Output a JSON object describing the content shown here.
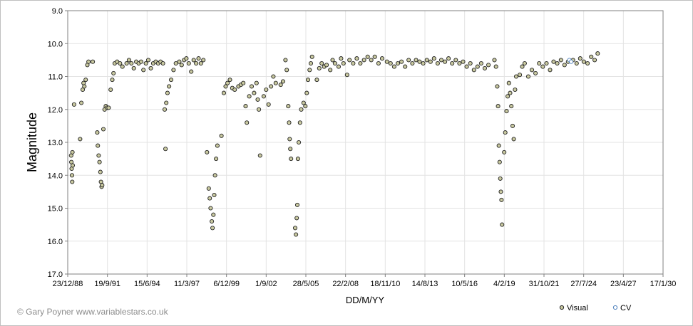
{
  "chart_data": {
    "type": "scatter",
    "title": "",
    "xlabel": "DD/M/YY",
    "ylabel": "Magnitude",
    "x_ticks": [
      "23/12/88",
      "19/9/91",
      "15/6/94",
      "11/3/97",
      "6/12/99",
      "1/9/02",
      "28/5/05",
      "22/2/08",
      "18/11/10",
      "14/8/13",
      "10/5/16",
      "4/2/19",
      "31/10/21",
      "27/7/24",
      "23/4/27",
      "17/1/30"
    ],
    "y_ticks": [
      "9.0",
      "10.0",
      "11.0",
      "12.0",
      "13.0",
      "14.0",
      "15.0",
      "16.0",
      "17.0"
    ],
    "xlim": [
      "1988-12-23",
      "2030-01-17"
    ],
    "ylim": [
      17.0,
      9.0
    ],
    "y_inverted": true,
    "grid": true,
    "legend_position": "bottom-right",
    "series": [
      {
        "name": "Visual",
        "color": "#c9c9a0",
        "edge_color": "#222222",
        "points": [
          [
            "1989-03-20",
            13.4
          ],
          [
            "1989-03-25",
            13.6
          ],
          [
            "1989-04-01",
            13.8
          ],
          [
            "1989-04-10",
            14.0
          ],
          [
            "1989-04-15",
            14.2
          ],
          [
            "1989-04-20",
            13.3
          ],
          [
            "1989-04-28",
            13.7
          ],
          [
            "1989-06-01",
            11.85
          ],
          [
            "1989-11-01",
            12.9
          ],
          [
            "1989-12-01",
            11.8
          ],
          [
            "1990-01-05",
            11.4
          ],
          [
            "1990-01-25",
            11.2
          ],
          [
            "1990-02-15",
            11.3
          ],
          [
            "1990-03-20",
            11.1
          ],
          [
            "1990-05-01",
            10.65
          ],
          [
            "1990-06-01",
            10.55
          ],
          [
            "1990-09-15",
            10.55
          ],
          [
            "1991-01-05",
            12.7
          ],
          [
            "1991-01-20",
            13.1
          ],
          [
            "1991-02-10",
            13.4
          ],
          [
            "1991-03-05",
            13.6
          ],
          [
            "1991-03-25",
            13.9
          ],
          [
            "1991-04-10",
            14.2
          ],
          [
            "1991-04-25",
            14.35
          ],
          [
            "1991-05-10",
            14.3
          ],
          [
            "1991-06-10",
            12.6
          ],
          [
            "1991-07-10",
            12.0
          ],
          [
            "1991-08-10",
            11.9
          ],
          [
            "1991-09-10",
            11.95
          ],
          [
            "1991-10-20",
            11.95
          ],
          [
            "1991-12-10",
            11.4
          ],
          [
            "1992-01-20",
            11.1
          ],
          [
            "1992-02-20",
            10.9
          ],
          [
            "1992-03-20",
            10.6
          ],
          [
            "1992-05-20",
            10.55
          ],
          [
            "1992-08-01",
            10.6
          ],
          [
            "1992-10-01",
            10.7
          ],
          [
            "1993-01-15",
            10.6
          ],
          [
            "1993-03-15",
            10.5
          ],
          [
            "1993-05-15",
            10.6
          ],
          [
            "1993-07-15",
            10.75
          ],
          [
            "1993-09-15",
            10.55
          ],
          [
            "1993-11-15",
            10.6
          ],
          [
            "1994-01-15",
            10.55
          ],
          [
            "1994-03-15",
            10.8
          ],
          [
            "1994-05-15",
            10.6
          ],
          [
            "1994-07-15",
            10.5
          ],
          [
            "1994-09-15",
            10.75
          ],
          [
            "1994-11-15",
            10.6
          ],
          [
            "1995-01-20",
            10.55
          ],
          [
            "1995-03-20",
            10.6
          ],
          [
            "1995-05-20",
            10.55
          ],
          [
            "1995-07-20",
            10.6
          ],
          [
            "1995-09-01",
            12.0
          ],
          [
            "1995-09-20",
            13.2
          ],
          [
            "1995-10-10",
            11.8
          ],
          [
            "1995-11-10",
            11.5
          ],
          [
            "1995-12-20",
            11.3
          ],
          [
            "1996-02-10",
            11.1
          ],
          [
            "1996-04-10",
            10.8
          ],
          [
            "1996-06-10",
            10.6
          ],
          [
            "1996-09-01",
            10.55
          ],
          [
            "1996-11-01",
            10.65
          ],
          [
            "1997-01-01",
            10.5
          ],
          [
            "1997-03-01",
            10.45
          ],
          [
            "1997-05-01",
            10.6
          ],
          [
            "1997-07-01",
            10.85
          ],
          [
            "1997-09-01",
            10.5
          ],
          [
            "1997-11-01",
            10.6
          ],
          [
            "1998-01-01",
            10.45
          ],
          [
            "1998-03-01",
            10.6
          ],
          [
            "1998-05-01",
            10.5
          ],
          [
            "1998-08-01",
            13.3
          ],
          [
            "1998-09-15",
            14.4
          ],
          [
            "1998-10-10",
            14.7
          ],
          [
            "1998-11-01",
            15.0
          ],
          [
            "1998-12-01",
            15.4
          ],
          [
            "1998-12-20",
            15.6
          ],
          [
            "1999-01-10",
            15.2
          ],
          [
            "1999-02-01",
            14.6
          ],
          [
            "1999-02-20",
            14.0
          ],
          [
            "1999-03-20",
            13.5
          ],
          [
            "1999-04-20",
            13.1
          ],
          [
            "1999-08-01",
            12.8
          ],
          [
            "1999-10-01",
            11.5
          ],
          [
            "1999-11-15",
            11.3
          ],
          [
            "2000-01-01",
            11.2
          ],
          [
            "2000-03-01",
            11.1
          ],
          [
            "2000-05-01",
            11.35
          ],
          [
            "2000-07-01",
            11.4
          ],
          [
            "2000-10-01",
            11.3
          ],
          [
            "2000-12-01",
            11.25
          ],
          [
            "2001-02-01",
            11.2
          ],
          [
            "2001-04-01",
            11.9
          ],
          [
            "2001-05-01",
            12.4
          ],
          [
            "2001-07-01",
            11.6
          ],
          [
            "2001-09-01",
            11.3
          ],
          [
            "2001-11-01",
            11.5
          ],
          [
            "2002-01-01",
            11.2
          ],
          [
            "2002-02-01",
            11.7
          ],
          [
            "2002-03-01",
            12.0
          ],
          [
            "2002-04-01",
            13.4
          ],
          [
            "2002-07-01",
            11.6
          ],
          [
            "2002-09-01",
            11.4
          ],
          [
            "2002-11-01",
            11.85
          ],
          [
            "2003-01-01",
            11.3
          ],
          [
            "2003-03-01",
            11.0
          ],
          [
            "2003-05-01",
            11.2
          ],
          [
            "2003-09-01",
            11.25
          ],
          [
            "2003-11-01",
            11.15
          ],
          [
            "2004-01-01",
            10.5
          ],
          [
            "2004-02-01",
            10.8
          ],
          [
            "2004-03-10",
            11.9
          ],
          [
            "2004-04-01",
            12.4
          ],
          [
            "2004-04-15",
            12.9
          ],
          [
            "2004-05-01",
            13.2
          ],
          [
            "2004-05-20",
            13.5
          ],
          [
            "2004-09-01",
            15.6
          ],
          [
            "2004-09-20",
            15.8
          ],
          [
            "2004-10-10",
            15.3
          ],
          [
            "2004-10-25",
            14.9
          ],
          [
            "2004-11-10",
            13.5
          ],
          [
            "2004-12-01",
            13.0
          ],
          [
            "2005-01-01",
            12.4
          ],
          [
            "2005-02-01",
            12.0
          ],
          [
            "2005-04-01",
            11.8
          ],
          [
            "2005-05-15",
            11.9
          ],
          [
            "2005-06-20",
            11.5
          ],
          [
            "2005-07-20",
            11.1
          ],
          [
            "2005-09-01",
            10.8
          ],
          [
            "2005-10-01",
            10.6
          ],
          [
            "2005-11-01",
            10.4
          ],
          [
            "2006-03-01",
            11.1
          ],
          [
            "2006-05-01",
            10.75
          ],
          [
            "2006-07-01",
            10.6
          ],
          [
            "2006-09-01",
            10.7
          ],
          [
            "2006-11-01",
            10.65
          ],
          [
            "2007-02-01",
            10.8
          ],
          [
            "2007-04-01",
            10.5
          ],
          [
            "2007-06-01",
            10.6
          ],
          [
            "2007-09-01",
            10.7
          ],
          [
            "2007-11-01",
            10.45
          ],
          [
            "2008-01-01",
            10.6
          ],
          [
            "2008-04-01",
            10.95
          ],
          [
            "2008-06-01",
            10.5
          ],
          [
            "2008-09-01",
            10.6
          ],
          [
            "2008-12-01",
            10.45
          ],
          [
            "2009-03-01",
            10.6
          ],
          [
            "2009-06-01",
            10.5
          ],
          [
            "2009-09-01",
            10.4
          ],
          [
            "2009-12-01",
            10.5
          ],
          [
            "2010-03-01",
            10.4
          ],
          [
            "2010-06-01",
            10.6
          ],
          [
            "2010-09-01",
            10.45
          ],
          [
            "2011-01-01",
            10.55
          ],
          [
            "2011-04-01",
            10.6
          ],
          [
            "2011-07-01",
            10.7
          ],
          [
            "2011-10-01",
            10.6
          ],
          [
            "2012-01-01",
            10.55
          ],
          [
            "2012-04-01",
            10.7
          ],
          [
            "2012-07-01",
            10.5
          ],
          [
            "2012-10-01",
            10.6
          ],
          [
            "2013-01-01",
            10.5
          ],
          [
            "2013-04-01",
            10.55
          ],
          [
            "2013-07-01",
            10.6
          ],
          [
            "2013-10-01",
            10.5
          ],
          [
            "2014-01-01",
            10.55
          ],
          [
            "2014-04-01",
            10.45
          ],
          [
            "2014-07-01",
            10.6
          ],
          [
            "2014-10-01",
            10.5
          ],
          [
            "2015-01-01",
            10.55
          ],
          [
            "2015-04-01",
            10.45
          ],
          [
            "2015-07-01",
            10.6
          ],
          [
            "2015-10-01",
            10.5
          ],
          [
            "2016-01-01",
            10.6
          ],
          [
            "2016-04-01",
            10.55
          ],
          [
            "2016-07-01",
            10.7
          ],
          [
            "2016-10-01",
            10.6
          ],
          [
            "2017-01-01",
            10.8
          ],
          [
            "2017-04-01",
            10.7
          ],
          [
            "2017-07-01",
            10.6
          ],
          [
            "2017-10-01",
            10.75
          ],
          [
            "2018-01-01",
            10.65
          ],
          [
            "2018-06-01",
            10.5
          ],
          [
            "2018-07-10",
            10.7
          ],
          [
            "2018-08-10",
            11.3
          ],
          [
            "2018-09-01",
            11.9
          ],
          [
            "2018-09-20",
            13.1
          ],
          [
            "2018-10-10",
            13.6
          ],
          [
            "2018-10-25",
            14.1
          ],
          [
            "2018-11-10",
            14.5
          ],
          [
            "2018-11-25",
            14.75
          ],
          [
            "2018-12-10",
            15.5
          ],
          [
            "2019-02-01",
            13.3
          ],
          [
            "2019-03-01",
            12.7
          ],
          [
            "2019-04-01",
            12.05
          ],
          [
            "2019-05-01",
            11.6
          ],
          [
            "2019-06-01",
            11.2
          ],
          [
            "2019-07-01",
            11.5
          ],
          [
            "2019-08-01",
            11.9
          ],
          [
            "2019-09-01",
            12.5
          ],
          [
            "2019-10-01",
            12.9
          ],
          [
            "2019-11-01",
            11.4
          ],
          [
            "2019-12-01",
            11.0
          ],
          [
            "2020-03-01",
            10.95
          ],
          [
            "2020-05-01",
            10.7
          ],
          [
            "2020-07-01",
            10.6
          ],
          [
            "2020-10-01",
            11.0
          ],
          [
            "2021-01-01",
            10.8
          ],
          [
            "2021-04-01",
            10.9
          ],
          [
            "2021-07-01",
            10.6
          ],
          [
            "2021-10-01",
            10.7
          ],
          [
            "2022-01-01",
            10.6
          ],
          [
            "2022-04-01",
            10.8
          ],
          [
            "2022-07-01",
            10.55
          ],
          [
            "2022-10-01",
            10.6
          ],
          [
            "2023-01-01",
            10.5
          ],
          [
            "2023-04-01",
            10.65
          ],
          [
            "2023-07-01",
            10.55
          ],
          [
            "2023-11-01",
            10.5
          ],
          [
            "2024-02-01",
            10.6
          ],
          [
            "2024-05-01",
            10.45
          ],
          [
            "2024-08-01",
            10.55
          ],
          [
            "2024-11-01",
            10.6
          ],
          [
            "2025-02-01",
            10.4
          ],
          [
            "2025-05-01",
            10.5
          ],
          [
            "2025-07-15",
            10.3
          ]
        ]
      },
      {
        "name": "CV",
        "color": "#4f81bd",
        "points": [
          [
            "2023-08-01",
            10.5
          ],
          [
            "2023-09-15",
            10.55
          ]
        ]
      }
    ]
  },
  "credit": "© Gary Poyner www.variablestars.co.uk",
  "legend": [
    {
      "label": "Visual",
      "marker": "filled-circle"
    },
    {
      "label": "CV",
      "marker": "open-circle"
    }
  ]
}
